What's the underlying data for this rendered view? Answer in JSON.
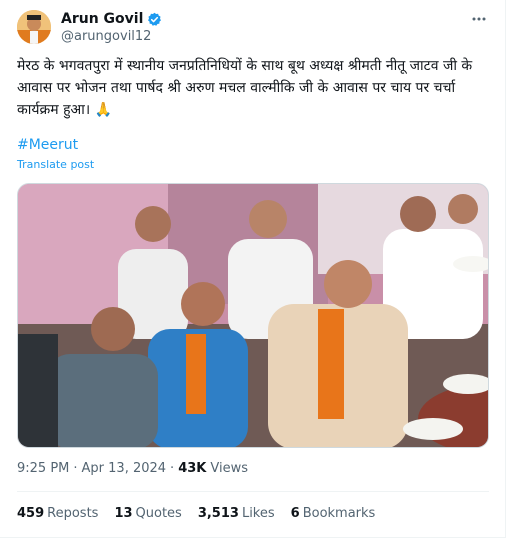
{
  "author": {
    "display_name": "Arun Govil",
    "handle": "@arungovil12",
    "verified": true,
    "badge_color": "#1d9bf0"
  },
  "tweet": {
    "text": "मेरठ के भगवतपुरा  में स्थानीय जनप्रतिनिधियों के साथ बूथ अध्यक्ष श्रीमती नीतू जाटव जी के आवास पर भोजन तथा पार्षद श्री अरुण मचल वाल्मीकि जी के आवास पर चाय पर चर्चा कार्यक्रम हुआ। 🙏",
    "hashtag": "#Meerut",
    "translate_label": "Translate post"
  },
  "meta": {
    "time": "9:25 PM",
    "separator": "·",
    "date": "Apr 13, 2024",
    "views_count": "43K",
    "views_label": "Views"
  },
  "stats": {
    "reposts_count": "459",
    "reposts_label": "Reposts",
    "quotes_count": "13",
    "quotes_label": "Quotes",
    "likes_count": "3,513",
    "likes_label": "Likes",
    "bookmarks_count": "6",
    "bookmarks_label": "Bookmarks"
  },
  "icons": {
    "more": "more-dots-icon",
    "verified": "verified-badge-icon"
  }
}
